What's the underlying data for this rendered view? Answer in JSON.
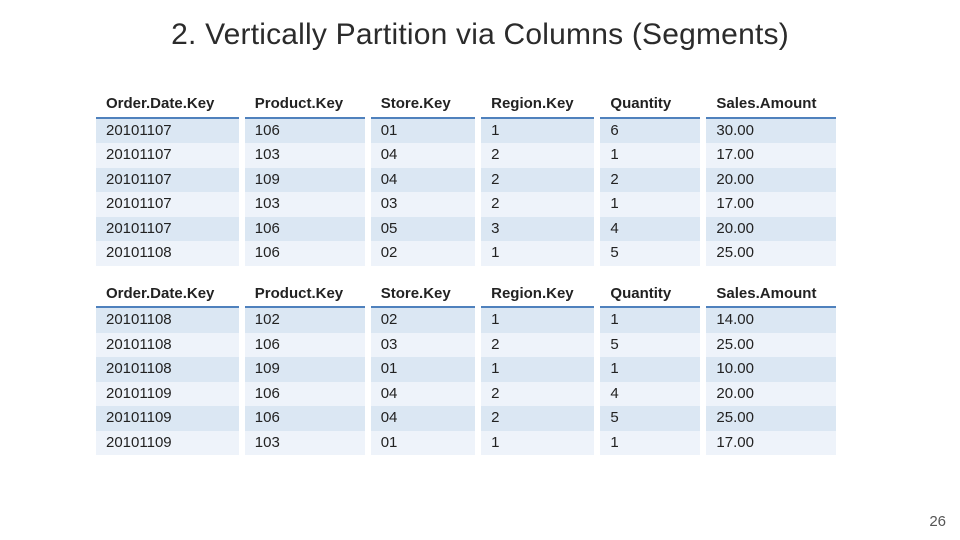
{
  "title": "2. Vertically Partition via Columns (Segments)",
  "slide_number": "26",
  "columns": [
    "Order.Date.Key",
    "Product.Key",
    "Store.Key",
    "Region.Key",
    "Quantity",
    "Sales.Amount"
  ],
  "segments": [
    {
      "rows": [
        {
          "order_date_key": "20101107",
          "product_key": "106",
          "store_key": "01",
          "region_key": "1",
          "quantity": "6",
          "sales_amount": "30.00"
        },
        {
          "order_date_key": "20101107",
          "product_key": "103",
          "store_key": "04",
          "region_key": "2",
          "quantity": "1",
          "sales_amount": "17.00"
        },
        {
          "order_date_key": "20101107",
          "product_key": "109",
          "store_key": "04",
          "region_key": "2",
          "quantity": "2",
          "sales_amount": "20.00"
        },
        {
          "order_date_key": "20101107",
          "product_key": "103",
          "store_key": "03",
          "region_key": "2",
          "quantity": "1",
          "sales_amount": "17.00"
        },
        {
          "order_date_key": "20101107",
          "product_key": "106",
          "store_key": "05",
          "region_key": "3",
          "quantity": "4",
          "sales_amount": "20.00"
        },
        {
          "order_date_key": "20101108",
          "product_key": "106",
          "store_key": "02",
          "region_key": "1",
          "quantity": "5",
          "sales_amount": "25.00"
        }
      ]
    },
    {
      "rows": [
        {
          "order_date_key": "20101108",
          "product_key": "102",
          "store_key": "02",
          "region_key": "1",
          "quantity": "1",
          "sales_amount": "14.00"
        },
        {
          "order_date_key": "20101108",
          "product_key": "106",
          "store_key": "03",
          "region_key": "2",
          "quantity": "5",
          "sales_amount": "25.00"
        },
        {
          "order_date_key": "20101108",
          "product_key": "109",
          "store_key": "01",
          "region_key": "1",
          "quantity": "1",
          "sales_amount": "10.00"
        },
        {
          "order_date_key": "20101109",
          "product_key": "106",
          "store_key": "04",
          "region_key": "2",
          "quantity": "4",
          "sales_amount": "20.00"
        },
        {
          "order_date_key": "20101109",
          "product_key": "106",
          "store_key": "04",
          "region_key": "2",
          "quantity": "5",
          "sales_amount": "25.00"
        },
        {
          "order_date_key": "20101109",
          "product_key": "103",
          "store_key": "01",
          "region_key": "1",
          "quantity": "1",
          "sales_amount": "17.00"
        }
      ]
    }
  ]
}
